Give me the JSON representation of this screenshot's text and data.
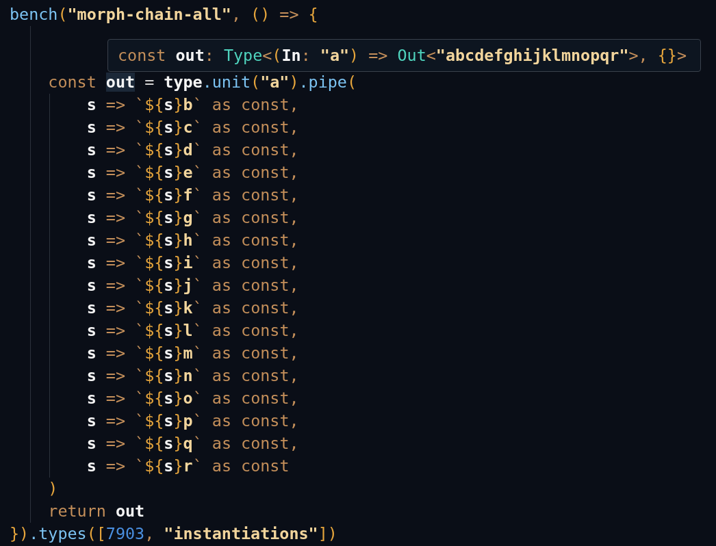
{
  "editor": {
    "lines": [
      {
        "tokens": [
          {
            "kind": "fn",
            "text": "bench"
          },
          {
            "kind": "paren",
            "text": "("
          },
          {
            "kind": "str",
            "text": "\"morph-chain-all\""
          },
          {
            "kind": "punc",
            "text": ", "
          },
          {
            "kind": "paren",
            "text": "()"
          },
          {
            "kind": "kw",
            "text": " => "
          },
          {
            "kind": "paren",
            "text": "{"
          }
        ],
        "children": [
          {
            "tokens": [
              {
                "kind": "kw",
                "text": "const "
              },
              {
                "kind": "var",
                "text": "out",
                "highlighted": true
              },
              {
                "kind": "plain",
                "text": " = "
              },
              {
                "kind": "var",
                "text": "type"
              },
              {
                "kind": "fn",
                "text": ".unit"
              },
              {
                "kind": "paren",
                "text": "("
              },
              {
                "kind": "str",
                "text": "\"a\""
              },
              {
                "kind": "paren",
                "text": ")"
              },
              {
                "kind": "fn",
                "text": ".pipe"
              },
              {
                "kind": "paren",
                "text": "("
              }
            ],
            "children": [
              {
                "tokens": [
                  {
                    "kind": "var",
                    "text": "s"
                  },
                  {
                    "kind": "kw",
                    "text": " => "
                  },
                  {
                    "kind": "punc",
                    "text": "`"
                  },
                  {
                    "kind": "paren",
                    "text": "${"
                  },
                  {
                    "kind": "var",
                    "text": "s"
                  },
                  {
                    "kind": "paren",
                    "text": "}"
                  },
                  {
                    "kind": "str",
                    "text": "b"
                  },
                  {
                    "kind": "punc",
                    "text": "`"
                  },
                  {
                    "kind": "kw",
                    "text": " as const,"
                  }
                ]
              },
              {
                "tokens": [
                  {
                    "kind": "var",
                    "text": "s"
                  },
                  {
                    "kind": "kw",
                    "text": " => "
                  },
                  {
                    "kind": "punc",
                    "text": "`"
                  },
                  {
                    "kind": "paren",
                    "text": "${"
                  },
                  {
                    "kind": "var",
                    "text": "s"
                  },
                  {
                    "kind": "paren",
                    "text": "}"
                  },
                  {
                    "kind": "str",
                    "text": "c"
                  },
                  {
                    "kind": "punc",
                    "text": "`"
                  },
                  {
                    "kind": "kw",
                    "text": " as const,"
                  }
                ]
              },
              {
                "tokens": [
                  {
                    "kind": "var",
                    "text": "s"
                  },
                  {
                    "kind": "kw",
                    "text": " => "
                  },
                  {
                    "kind": "punc",
                    "text": "`"
                  },
                  {
                    "kind": "paren",
                    "text": "${"
                  },
                  {
                    "kind": "var",
                    "text": "s"
                  },
                  {
                    "kind": "paren",
                    "text": "}"
                  },
                  {
                    "kind": "str",
                    "text": "d"
                  },
                  {
                    "kind": "punc",
                    "text": "`"
                  },
                  {
                    "kind": "kw",
                    "text": " as const,"
                  }
                ]
              },
              {
                "tokens": [
                  {
                    "kind": "var",
                    "text": "s"
                  },
                  {
                    "kind": "kw",
                    "text": " => "
                  },
                  {
                    "kind": "punc",
                    "text": "`"
                  },
                  {
                    "kind": "paren",
                    "text": "${"
                  },
                  {
                    "kind": "var",
                    "text": "s"
                  },
                  {
                    "kind": "paren",
                    "text": "}"
                  },
                  {
                    "kind": "str",
                    "text": "e"
                  },
                  {
                    "kind": "punc",
                    "text": "`"
                  },
                  {
                    "kind": "kw",
                    "text": " as const,"
                  }
                ]
              },
              {
                "tokens": [
                  {
                    "kind": "var",
                    "text": "s"
                  },
                  {
                    "kind": "kw",
                    "text": " => "
                  },
                  {
                    "kind": "punc",
                    "text": "`"
                  },
                  {
                    "kind": "paren",
                    "text": "${"
                  },
                  {
                    "kind": "var",
                    "text": "s"
                  },
                  {
                    "kind": "paren",
                    "text": "}"
                  },
                  {
                    "kind": "str",
                    "text": "f"
                  },
                  {
                    "kind": "punc",
                    "text": "`"
                  },
                  {
                    "kind": "kw",
                    "text": " as const,"
                  }
                ]
              },
              {
                "tokens": [
                  {
                    "kind": "var",
                    "text": "s"
                  },
                  {
                    "kind": "kw",
                    "text": " => "
                  },
                  {
                    "kind": "punc",
                    "text": "`"
                  },
                  {
                    "kind": "paren",
                    "text": "${"
                  },
                  {
                    "kind": "var",
                    "text": "s"
                  },
                  {
                    "kind": "paren",
                    "text": "}"
                  },
                  {
                    "kind": "str",
                    "text": "g"
                  },
                  {
                    "kind": "punc",
                    "text": "`"
                  },
                  {
                    "kind": "kw",
                    "text": " as const,"
                  }
                ]
              },
              {
                "tokens": [
                  {
                    "kind": "var",
                    "text": "s"
                  },
                  {
                    "kind": "kw",
                    "text": " => "
                  },
                  {
                    "kind": "punc",
                    "text": "`"
                  },
                  {
                    "kind": "paren",
                    "text": "${"
                  },
                  {
                    "kind": "var",
                    "text": "s"
                  },
                  {
                    "kind": "paren",
                    "text": "}"
                  },
                  {
                    "kind": "str",
                    "text": "h"
                  },
                  {
                    "kind": "punc",
                    "text": "`"
                  },
                  {
                    "kind": "kw",
                    "text": " as const,"
                  }
                ]
              },
              {
                "tokens": [
                  {
                    "kind": "var",
                    "text": "s"
                  },
                  {
                    "kind": "kw",
                    "text": " => "
                  },
                  {
                    "kind": "punc",
                    "text": "`"
                  },
                  {
                    "kind": "paren",
                    "text": "${"
                  },
                  {
                    "kind": "var",
                    "text": "s"
                  },
                  {
                    "kind": "paren",
                    "text": "}"
                  },
                  {
                    "kind": "str",
                    "text": "i"
                  },
                  {
                    "kind": "punc",
                    "text": "`"
                  },
                  {
                    "kind": "kw",
                    "text": " as const,"
                  }
                ]
              },
              {
                "tokens": [
                  {
                    "kind": "var",
                    "text": "s"
                  },
                  {
                    "kind": "kw",
                    "text": " => "
                  },
                  {
                    "kind": "punc",
                    "text": "`"
                  },
                  {
                    "kind": "paren",
                    "text": "${"
                  },
                  {
                    "kind": "var",
                    "text": "s"
                  },
                  {
                    "kind": "paren",
                    "text": "}"
                  },
                  {
                    "kind": "str",
                    "text": "j"
                  },
                  {
                    "kind": "punc",
                    "text": "`"
                  },
                  {
                    "kind": "kw",
                    "text": " as const,"
                  }
                ]
              },
              {
                "tokens": [
                  {
                    "kind": "var",
                    "text": "s"
                  },
                  {
                    "kind": "kw",
                    "text": " => "
                  },
                  {
                    "kind": "punc",
                    "text": "`"
                  },
                  {
                    "kind": "paren",
                    "text": "${"
                  },
                  {
                    "kind": "var",
                    "text": "s"
                  },
                  {
                    "kind": "paren",
                    "text": "}"
                  },
                  {
                    "kind": "str",
                    "text": "k"
                  },
                  {
                    "kind": "punc",
                    "text": "`"
                  },
                  {
                    "kind": "kw",
                    "text": " as const,"
                  }
                ]
              },
              {
                "tokens": [
                  {
                    "kind": "var",
                    "text": "s"
                  },
                  {
                    "kind": "kw",
                    "text": " => "
                  },
                  {
                    "kind": "punc",
                    "text": "`"
                  },
                  {
                    "kind": "paren",
                    "text": "${"
                  },
                  {
                    "kind": "var",
                    "text": "s"
                  },
                  {
                    "kind": "paren",
                    "text": "}"
                  },
                  {
                    "kind": "str",
                    "text": "l"
                  },
                  {
                    "kind": "punc",
                    "text": "`"
                  },
                  {
                    "kind": "kw",
                    "text": " as const,"
                  }
                ]
              },
              {
                "tokens": [
                  {
                    "kind": "var",
                    "text": "s"
                  },
                  {
                    "kind": "kw",
                    "text": " => "
                  },
                  {
                    "kind": "punc",
                    "text": "`"
                  },
                  {
                    "kind": "paren",
                    "text": "${"
                  },
                  {
                    "kind": "var",
                    "text": "s"
                  },
                  {
                    "kind": "paren",
                    "text": "}"
                  },
                  {
                    "kind": "str",
                    "text": "m"
                  },
                  {
                    "kind": "punc",
                    "text": "`"
                  },
                  {
                    "kind": "kw",
                    "text": " as const,"
                  }
                ]
              },
              {
                "tokens": [
                  {
                    "kind": "var",
                    "text": "s"
                  },
                  {
                    "kind": "kw",
                    "text": " => "
                  },
                  {
                    "kind": "punc",
                    "text": "`"
                  },
                  {
                    "kind": "paren",
                    "text": "${"
                  },
                  {
                    "kind": "var",
                    "text": "s"
                  },
                  {
                    "kind": "paren",
                    "text": "}"
                  },
                  {
                    "kind": "str",
                    "text": "n"
                  },
                  {
                    "kind": "punc",
                    "text": "`"
                  },
                  {
                    "kind": "kw",
                    "text": " as const,"
                  }
                ]
              },
              {
                "tokens": [
                  {
                    "kind": "var",
                    "text": "s"
                  },
                  {
                    "kind": "kw",
                    "text": " => "
                  },
                  {
                    "kind": "punc",
                    "text": "`"
                  },
                  {
                    "kind": "paren",
                    "text": "${"
                  },
                  {
                    "kind": "var",
                    "text": "s"
                  },
                  {
                    "kind": "paren",
                    "text": "}"
                  },
                  {
                    "kind": "str",
                    "text": "o"
                  },
                  {
                    "kind": "punc",
                    "text": "`"
                  },
                  {
                    "kind": "kw",
                    "text": " as const,"
                  }
                ]
              },
              {
                "tokens": [
                  {
                    "kind": "var",
                    "text": "s"
                  },
                  {
                    "kind": "kw",
                    "text": " => "
                  },
                  {
                    "kind": "punc",
                    "text": "`"
                  },
                  {
                    "kind": "paren",
                    "text": "${"
                  },
                  {
                    "kind": "var",
                    "text": "s"
                  },
                  {
                    "kind": "paren",
                    "text": "}"
                  },
                  {
                    "kind": "str",
                    "text": "p"
                  },
                  {
                    "kind": "punc",
                    "text": "`"
                  },
                  {
                    "kind": "kw",
                    "text": " as const,"
                  }
                ]
              },
              {
                "tokens": [
                  {
                    "kind": "var",
                    "text": "s"
                  },
                  {
                    "kind": "kw",
                    "text": " => "
                  },
                  {
                    "kind": "punc",
                    "text": "`"
                  },
                  {
                    "kind": "paren",
                    "text": "${"
                  },
                  {
                    "kind": "var",
                    "text": "s"
                  },
                  {
                    "kind": "paren",
                    "text": "}"
                  },
                  {
                    "kind": "str",
                    "text": "q"
                  },
                  {
                    "kind": "punc",
                    "text": "`"
                  },
                  {
                    "kind": "kw",
                    "text": " as const,"
                  }
                ]
              },
              {
                "tokens": [
                  {
                    "kind": "var",
                    "text": "s"
                  },
                  {
                    "kind": "kw",
                    "text": " => "
                  },
                  {
                    "kind": "punc",
                    "text": "`"
                  },
                  {
                    "kind": "paren",
                    "text": "${"
                  },
                  {
                    "kind": "var",
                    "text": "s"
                  },
                  {
                    "kind": "paren",
                    "text": "}"
                  },
                  {
                    "kind": "str",
                    "text": "r"
                  },
                  {
                    "kind": "punc",
                    "text": "`"
                  },
                  {
                    "kind": "kw",
                    "text": " as const"
                  }
                ]
              }
            ]
          },
          {
            "tokens": [
              {
                "kind": "paren",
                "text": ")"
              }
            ]
          },
          {
            "tokens": [
              {
                "kind": "kw",
                "text": "return "
              },
              {
                "kind": "var",
                "text": "out"
              }
            ]
          }
        ]
      },
      {
        "tokens": [
          {
            "kind": "paren",
            "text": "})"
          },
          {
            "kind": "fn",
            "text": ".types"
          },
          {
            "kind": "paren",
            "text": "(["
          },
          {
            "kind": "num",
            "text": "7903"
          },
          {
            "kind": "punc",
            "text": ", "
          },
          {
            "kind": "str",
            "text": "\"instantiations\""
          },
          {
            "kind": "paren",
            "text": "])"
          }
        ]
      }
    ]
  },
  "hover_tooltip": {
    "tokens": [
      {
        "kind": "kw",
        "text": "const "
      },
      {
        "kind": "var",
        "text": "out"
      },
      {
        "kind": "punc",
        "text": ": "
      },
      {
        "kind": "type",
        "text": "Type"
      },
      {
        "kind": "punc",
        "text": "<"
      },
      {
        "kind": "paren",
        "text": "("
      },
      {
        "kind": "var",
        "text": "In"
      },
      {
        "kind": "punc",
        "text": ": "
      },
      {
        "kind": "str",
        "text": "\"a\""
      },
      {
        "kind": "paren",
        "text": ")"
      },
      {
        "kind": "kw",
        "text": " => "
      },
      {
        "kind": "type",
        "text": "Out"
      },
      {
        "kind": "punc",
        "text": "<"
      },
      {
        "kind": "str",
        "text": "\"abcdefghijklmnopqr\""
      },
      {
        "kind": "punc",
        "text": ">, "
      },
      {
        "kind": "paren",
        "text": "{}"
      },
      {
        "kind": "punc",
        "text": ">"
      }
    ]
  }
}
